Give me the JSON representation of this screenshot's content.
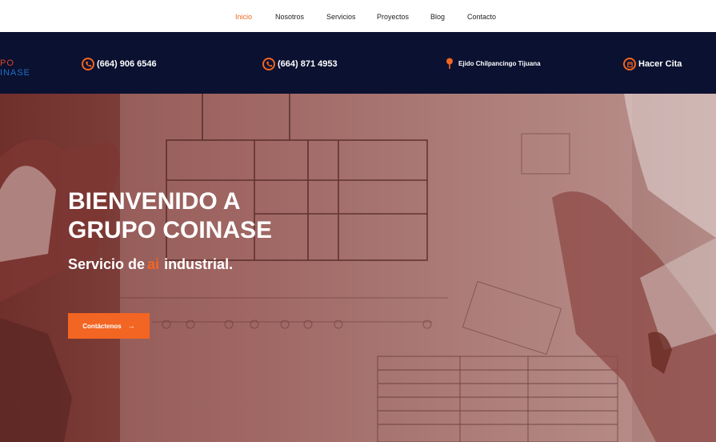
{
  "nav": {
    "items": [
      {
        "label": "Inicio",
        "active": true
      },
      {
        "label": "Nosotros"
      },
      {
        "label": "Servicios"
      },
      {
        "label": "Proyectos"
      },
      {
        "label": "Blog"
      },
      {
        "label": "Contacto"
      }
    ]
  },
  "infobar": {
    "logo": {
      "line1": "PO",
      "line2": "INASE"
    },
    "phone1": "(664) 906 6546",
    "phone2": "(664) 871 4953",
    "address": "Ejido Chilpancingo Tijuana",
    "appointment": "Hacer Cita"
  },
  "hero": {
    "title_line1": "BIENVENIDO A",
    "title_line2": "GRUPO COINASE",
    "subtitle_pre": "Servicio de",
    "subtitle_accent": "ai",
    "subtitle_post": "industrial.",
    "cta_label": "Contáctenos",
    "cta_arrow": "→"
  },
  "colors": {
    "accent": "#f26522",
    "infobar_bg": "#0b1130",
    "hero_overlay": "#7a3a36"
  },
  "icons": [
    "phone-icon",
    "phone-icon",
    "map-pin-icon",
    "calendar-icon",
    "arrow-right-icon"
  ]
}
